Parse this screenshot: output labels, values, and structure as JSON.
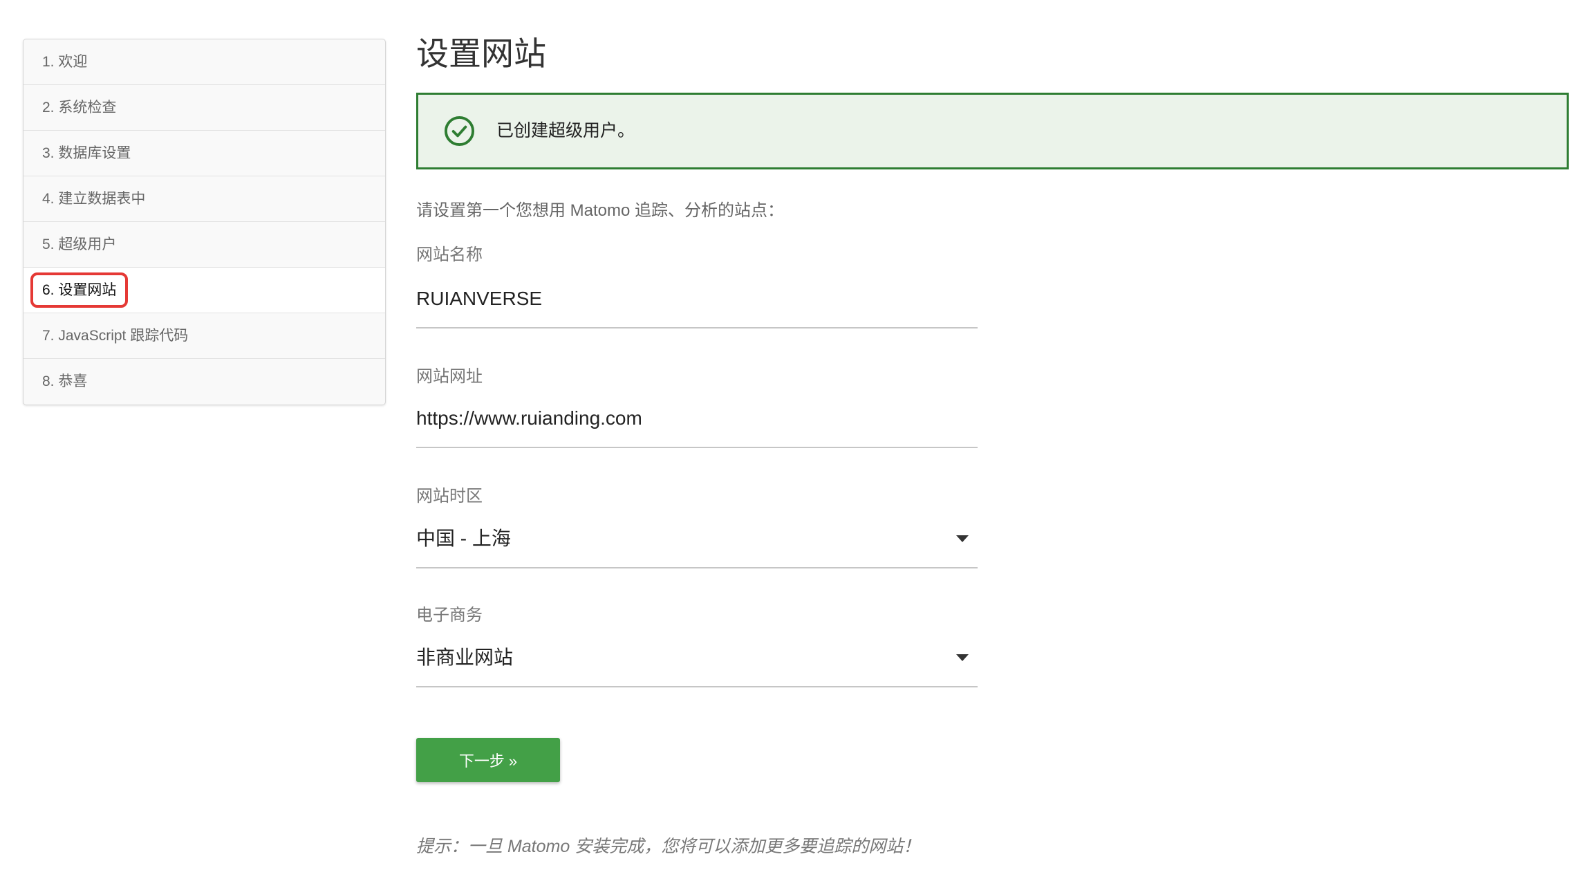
{
  "sidebar": {
    "items": [
      {
        "label": "1. 欢迎",
        "active": false
      },
      {
        "label": "2. 系统检查",
        "active": false
      },
      {
        "label": "3. 数据库设置",
        "active": false
      },
      {
        "label": "4. 建立数据表中",
        "active": false
      },
      {
        "label": "5. 超级用户",
        "active": false
      },
      {
        "label": "6. 设置网站",
        "active": true
      },
      {
        "label": "7. JavaScript 跟踪代码",
        "active": false
      },
      {
        "label": "8. 恭喜",
        "active": false
      }
    ]
  },
  "main": {
    "title": "设置网站",
    "notification": {
      "icon": "check-circle-icon",
      "text": "已创建超级用户。"
    },
    "intro": "请设置第一个您想用 Matomo 追踪、分析的站点：",
    "fields": {
      "site_name": {
        "label": "网站名称",
        "value": "RUIANVERSE"
      },
      "site_url": {
        "label": "网站网址",
        "value": "https://www.ruianding.com"
      },
      "timezone": {
        "label": "网站时区",
        "value": "中国 - 上海",
        "icon": "caret-down-icon"
      },
      "ecommerce": {
        "label": "电子商务",
        "value": "非商业网站",
        "icon": "caret-down-icon"
      }
    },
    "next_button": "下一步 »",
    "hint": "提示：一旦 Matomo 安装完成，您将可以添加更多要追踪的网站！"
  },
  "colors": {
    "button_green": "#43a047",
    "success_border": "#2e7d32",
    "success_background": "#ebf3ea",
    "highlight_red": "#e53935"
  }
}
